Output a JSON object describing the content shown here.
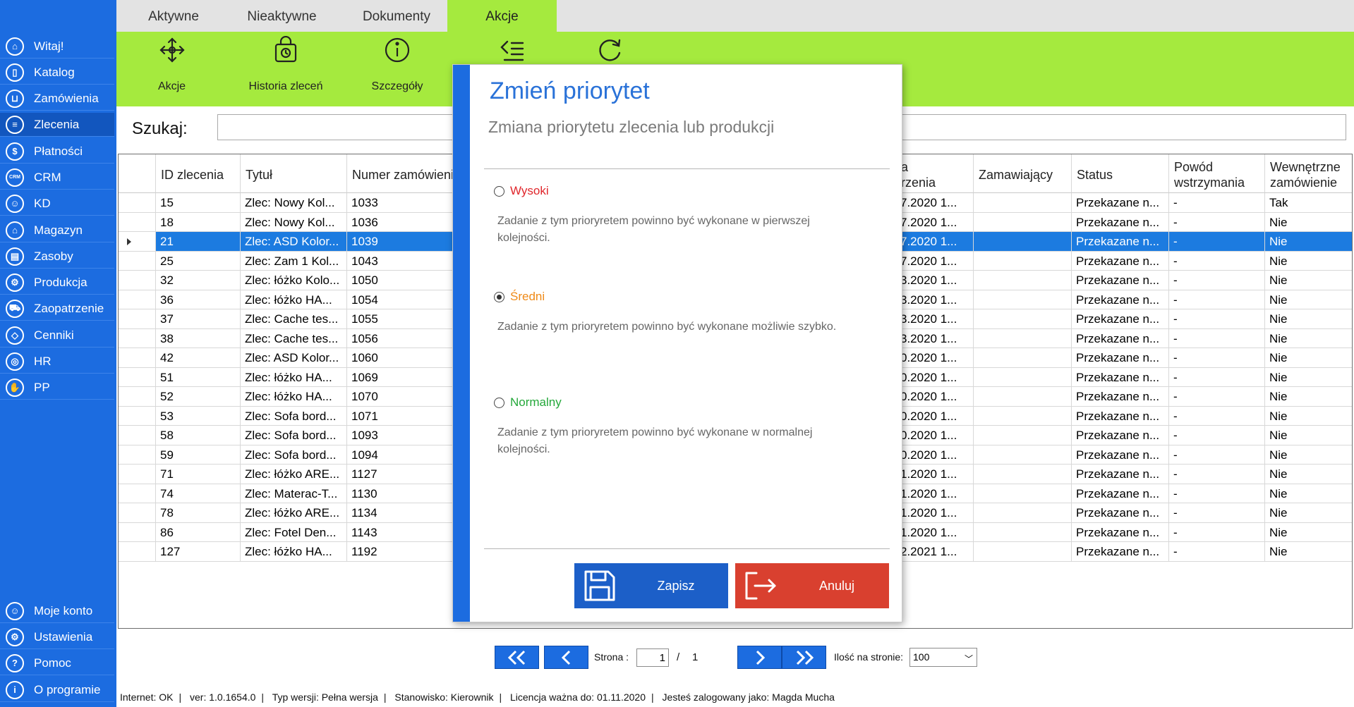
{
  "sidebar": {
    "items": [
      {
        "label": "Witaj!",
        "icon": "home-icon"
      },
      {
        "label": "Katalog",
        "icon": "book-icon"
      },
      {
        "label": "Zamówienia",
        "icon": "cart-icon"
      },
      {
        "label": "Zlecenia",
        "icon": "list-icon"
      },
      {
        "label": "Płatności",
        "icon": "dollar-icon"
      },
      {
        "label": "CRM",
        "icon": "crm-icon"
      },
      {
        "label": "KD",
        "icon": "user-icon"
      },
      {
        "label": "Magazyn",
        "icon": "warehouse-icon"
      },
      {
        "label": "Zasoby",
        "icon": "resources-icon"
      },
      {
        "label": "Produkcja",
        "icon": "production-icon"
      },
      {
        "label": "Zaopatrzenie",
        "icon": "truck-icon"
      },
      {
        "label": "Cenniki",
        "icon": "tag-icon"
      },
      {
        "label": "HR",
        "icon": "hr-icon"
      },
      {
        "label": "PP",
        "icon": "pp-icon"
      }
    ],
    "bottom": [
      {
        "label": "Moje konto",
        "icon": "account-icon"
      },
      {
        "label": "Ustawienia",
        "icon": "settings-icon"
      },
      {
        "label": "Pomoc",
        "icon": "help-icon"
      },
      {
        "label": "O programie",
        "icon": "info-icon"
      }
    ],
    "active_label": "Zlecenia"
  },
  "tabs": [
    "Aktywne",
    "Nieaktywne",
    "Dokumenty",
    "Akcje"
  ],
  "active_tab": "Akcje",
  "ribbon": {
    "buttons": [
      {
        "label": "Akcje",
        "icon": "move-icon"
      },
      {
        "label": "Historia zleceń",
        "icon": "history-icon"
      },
      {
        "label": "Szczegóły",
        "icon": "info-icon"
      },
      {
        "label": "",
        "icon": "priority-icon"
      },
      {
        "label": "",
        "icon": "refresh-icon"
      }
    ]
  },
  "search": {
    "label": "Szukaj:",
    "value": ""
  },
  "table": {
    "headers": {
      "id": "ID zlecenia",
      "title": "Tytuł",
      "number": "Numer zamówienia",
      "date_fragment": "a\nrzenia",
      "ordering": "Zamawiający",
      "status": "Status",
      "reason": "Powód wstrzymania",
      "internal": "Wewnętrzne zamówienie"
    },
    "rows": [
      {
        "id": "15",
        "title": "Zlec: Nowy Kol...",
        "number": "1033",
        "date": "7.2020 1...",
        "ordering": "",
        "status": "Przekazane n...",
        "reason": "-",
        "internal": "Tak"
      },
      {
        "id": "18",
        "title": "Zlec: Nowy Kol...",
        "number": "1036",
        "date": "7.2020 1...",
        "ordering": "",
        "status": "Przekazane n...",
        "reason": "-",
        "internal": "Nie"
      },
      {
        "id": "21",
        "title": "Zlec: ASD Kolor...",
        "number": "1039",
        "date": "7.2020 1...",
        "ordering": "",
        "status": "Przekazane n...",
        "reason": "-",
        "internal": "Nie"
      },
      {
        "id": "25",
        "title": "Zlec: Zam 1 Kol...",
        "number": "1043",
        "date": "7.2020 1...",
        "ordering": "",
        "status": "Przekazane n...",
        "reason": "-",
        "internal": "Nie"
      },
      {
        "id": "32",
        "title": "Zlec: łóżko Kolo...",
        "number": "1050",
        "date": "3.2020 1...",
        "ordering": "",
        "status": "Przekazane n...",
        "reason": "-",
        "internal": "Nie"
      },
      {
        "id": "36",
        "title": "Zlec: łóżko HA...",
        "number": "1054",
        "date": "3.2020 1...",
        "ordering": "",
        "status": "Przekazane n...",
        "reason": "-",
        "internal": "Nie"
      },
      {
        "id": "37",
        "title": "Zlec: Cache tes...",
        "number": "1055",
        "date": "3.2020 1...",
        "ordering": "",
        "status": "Przekazane n...",
        "reason": "-",
        "internal": "Nie"
      },
      {
        "id": "38",
        "title": "Zlec: Cache tes...",
        "number": "1056",
        "date": "3.2020 1...",
        "ordering": "",
        "status": "Przekazane n...",
        "reason": "-",
        "internal": "Nie"
      },
      {
        "id": "42",
        "title": "Zlec: ASD Kolor...",
        "number": "1060",
        "date": "0.2020 1...",
        "ordering": "",
        "status": "Przekazane n...",
        "reason": "-",
        "internal": "Nie"
      },
      {
        "id": "51",
        "title": "Zlec: łóżko HA...",
        "number": "1069",
        "date": "0.2020 1...",
        "ordering": "",
        "status": "Przekazane n...",
        "reason": "-",
        "internal": "Nie"
      },
      {
        "id": "52",
        "title": "Zlec: łóżko HA...",
        "number": "1070",
        "date": "0.2020 1...",
        "ordering": "",
        "status": "Przekazane n...",
        "reason": "-",
        "internal": "Nie"
      },
      {
        "id": "53",
        "title": "Zlec: Sofa bord...",
        "number": "1071",
        "date": "0.2020 1...",
        "ordering": "",
        "status": "Przekazane n...",
        "reason": "-",
        "internal": "Nie"
      },
      {
        "id": "58",
        "title": "Zlec: Sofa bord...",
        "number": "1093",
        "date": "0.2020 1...",
        "ordering": "",
        "status": "Przekazane n...",
        "reason": "-",
        "internal": "Nie"
      },
      {
        "id": "59",
        "title": "Zlec: Sofa bord...",
        "number": "1094",
        "date": "0.2020 1...",
        "ordering": "",
        "status": "Przekazane n...",
        "reason": "-",
        "internal": "Nie"
      },
      {
        "id": "71",
        "title": "Zlec: łóżko ARE...",
        "number": "1127",
        "date": "1.2020 1...",
        "ordering": "",
        "status": "Przekazane n...",
        "reason": "-",
        "internal": "Nie"
      },
      {
        "id": "74",
        "title": "Zlec: Materac-T...",
        "number": "1130",
        "date": "1.2020 1...",
        "ordering": "",
        "status": "Przekazane n...",
        "reason": "-",
        "internal": "Nie"
      },
      {
        "id": "78",
        "title": "Zlec: łóżko ARE...",
        "number": "1134",
        "date": "1.2020 1...",
        "ordering": "",
        "status": "Przekazane n...",
        "reason": "-",
        "internal": "Nie"
      },
      {
        "id": "86",
        "title": "Zlec: Fotel Den...",
        "number": "1143",
        "date": "1.2020 1...",
        "ordering": "",
        "status": "Przekazane n...",
        "reason": "-",
        "internal": "Nie"
      },
      {
        "id": "127",
        "title": "Zlec: łóżko HA...",
        "number": "1192",
        "date": "2.2021 1...",
        "ordering": "",
        "status": "Przekazane n...",
        "reason": "-",
        "internal": "Nie"
      }
    ],
    "selected_id": "21"
  },
  "pager": {
    "page_label": "Strona :",
    "current_page": "1",
    "separator": "/",
    "total_pages": "1",
    "per_page_label": "Ilość na stronie:",
    "per_page_value": "100"
  },
  "status_bar": [
    "Internet: OK",
    "ver: 1.0.1654.0",
    "Typ wersji: Pełna wersja",
    "Stanowisko: Kierownik",
    "Licencja ważna do: 01.11.2020",
    "Jesteś zalogowany jako: Magda Mucha"
  ],
  "modal": {
    "title": "Zmień priorytet",
    "subtitle": "Zmiana priorytetu zlecenia lub produkcji",
    "options": [
      {
        "label": "Wysoki",
        "color": "#e0262b",
        "description": "Zadanie z tym prioryretem powinno być wykonane w pierwszej kolejności.",
        "selected": false
      },
      {
        "label": "Średni",
        "color": "#ef8a17",
        "description": "Zadanie z tym prioryretem powinno być wykonane możliwie szybko.",
        "selected": true
      },
      {
        "label": "Normalny",
        "color": "#24a83a",
        "description": "Zadanie z tym prioryretem powinno być wykonane w normalnej kolejności.",
        "selected": false
      }
    ],
    "save_label": "Zapisz",
    "cancel_label": "Anuluj"
  },
  "colors": {
    "sidebar": "#1c6ce0",
    "ribbon": "#a5ea3e",
    "selected_row": "#1c7be0",
    "save_button": "#1c5fc8",
    "cancel_button": "#d9402f"
  }
}
